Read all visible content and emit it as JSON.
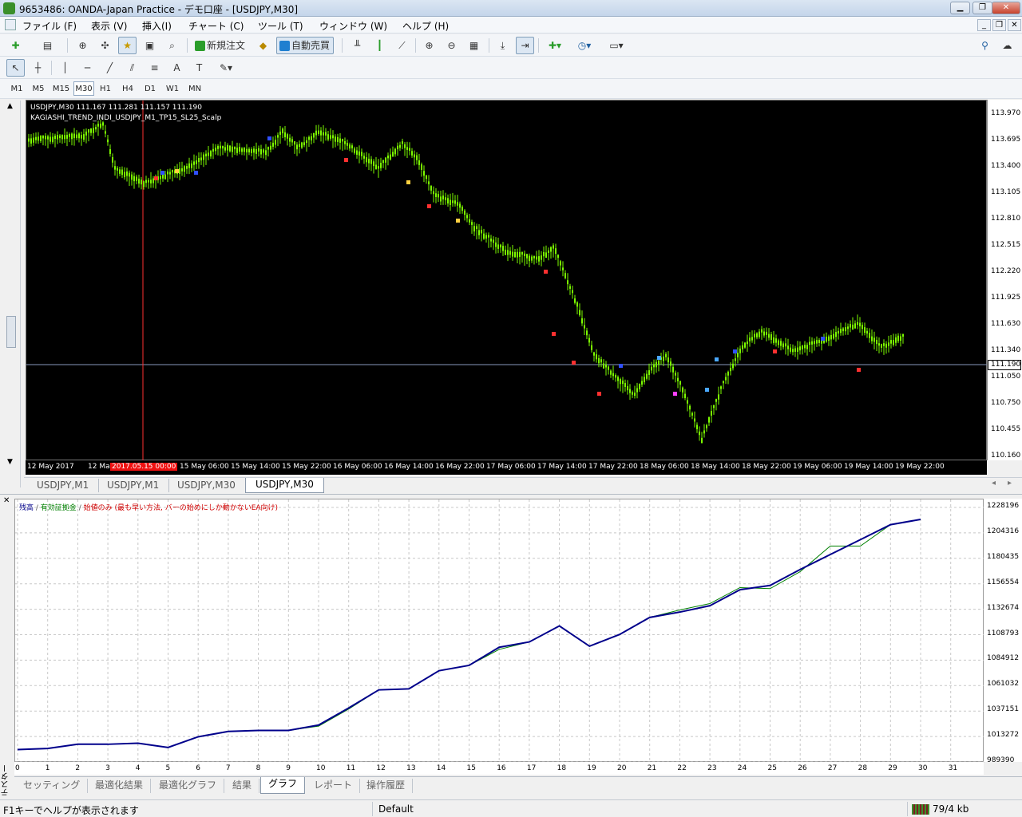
{
  "window": {
    "title": "9653486: OANDA-Japan Practice - デモ口座 - [USDJPY,M30]"
  },
  "menu": [
    "ファイル (F)",
    "表示 (V)",
    "挿入(I)",
    "チャート (C)",
    "ツール (T)",
    "ウィンドウ (W)",
    "ヘルプ (H)"
  ],
  "toolbar": {
    "new_order": "新規注文",
    "auto_trading": "自動売買"
  },
  "timeframes": [
    "M1",
    "M5",
    "M15",
    "M30",
    "H1",
    "H4",
    "D1",
    "W1",
    "MN"
  ],
  "active_timeframe": "M30",
  "chart": {
    "info_line": "USDJPY,M30  111.167 111.281 111.157 111.190",
    "indicator": "KAGIASHI_TREND_INDI_USDJPY_M1_TP15_SL25_Scalp",
    "current_price": "111.190",
    "price_labels": [
      "113.970",
      "113.695",
      "113.400",
      "113.105",
      "112.810",
      "112.515",
      "112.220",
      "111.925",
      "111.630",
      "111.340",
      "111.190",
      "111.050",
      "110.750",
      "110.455",
      "110.160"
    ],
    "time_labels": [
      "12 May 2017",
      "12 May 1",
      "2017.05.15 00:00",
      "15 May 06:00",
      "15 May 14:00",
      "15 May 22:00",
      "16 May 06:00",
      "16 May 14:00",
      "16 May 22:00",
      "17 May 06:00",
      "17 May 14:00",
      "17 May 22:00",
      "18 May 06:00",
      "18 May 14:00",
      "18 May 22:00",
      "19 May 06:00",
      "19 May 14:00",
      "19 May 22:00"
    ],
    "highlighted_time": "2017.05.15 00:00",
    "colors": {
      "background": "#000000",
      "candle": "#7CFC00",
      "crosshair": "#ff3030",
      "price_line": "#8899bb"
    }
  },
  "chart_tabs": [
    "USDJPY,M1",
    "USDJPY,M1",
    "USDJPY,M30",
    "USDJPY,M30"
  ],
  "active_chart_tab": "USDJPY,M30",
  "tester": {
    "side_label": "テスター",
    "legend": {
      "balance": "残高",
      "equity": "有効証拠金",
      "mode": "始値のみ (最も早い方法, バーの始めにしか動かないEA向け)"
    },
    "tabs": [
      "セッティング",
      "最適化結果",
      "最適化グラフ",
      "結果",
      "グラフ",
      "レポート",
      "操作履歴"
    ],
    "active_tab": "グラフ",
    "y_labels": [
      "1228196",
      "1204316",
      "1180435",
      "1156554",
      "1132674",
      "1108793",
      "1084912",
      "1061032",
      "1037151",
      "1013272",
      "989390"
    ],
    "x_labels": [
      "0",
      "1",
      "2",
      "3",
      "4",
      "5",
      "6",
      "7",
      "8",
      "9",
      "10",
      "11",
      "12",
      "13",
      "14",
      "15",
      "16",
      "17",
      "18",
      "19",
      "20",
      "21",
      "22",
      "23",
      "24",
      "25",
      "26",
      "27",
      "28",
      "29",
      "30",
      "31"
    ]
  },
  "chart_data": {
    "type": "line",
    "ylim": [
      989390,
      1228196
    ],
    "x": [
      0,
      1,
      2,
      3,
      4,
      5,
      6,
      7,
      8,
      9,
      10,
      11,
      12,
      13,
      14,
      15,
      16,
      17,
      18,
      19,
      20,
      21,
      22,
      23,
      24,
      25,
      26,
      27,
      28,
      29,
      30
    ],
    "series": [
      {
        "name": "残高",
        "color": "#00008b",
        "values": [
          1001000,
          1002000,
          1006000,
          1006000,
          1007000,
          1003000,
          1013000,
          1018000,
          1019000,
          1019000,
          1024000,
          1040000,
          1057000,
          1058000,
          1075000,
          1080000,
          1097000,
          1102000,
          1117000,
          1098000,
          1109000,
          1125000,
          1130000,
          1136000,
          1151000,
          1155000,
          1170000,
          1184000,
          1198000,
          1212000,
          1217000
        ]
      },
      {
        "name": "有効証拠金",
        "color": "#008000",
        "values": [
          1001000,
          1002000,
          1006000,
          1006000,
          1007000,
          1003000,
          1013000,
          1018000,
          1019000,
          1019000,
          1023000,
          1039000,
          1057000,
          1058000,
          1075000,
          1080000,
          1095000,
          1102000,
          1117000,
          1098000,
          1109000,
          1125000,
          1132000,
          1138000,
          1153000,
          1152000,
          1168000,
          1192000,
          1192000,
          1212000,
          1217000
        ]
      }
    ]
  },
  "status": {
    "help": "F1キーでヘルプが表示されます",
    "profile": "Default",
    "traffic": "79/4 kb"
  }
}
